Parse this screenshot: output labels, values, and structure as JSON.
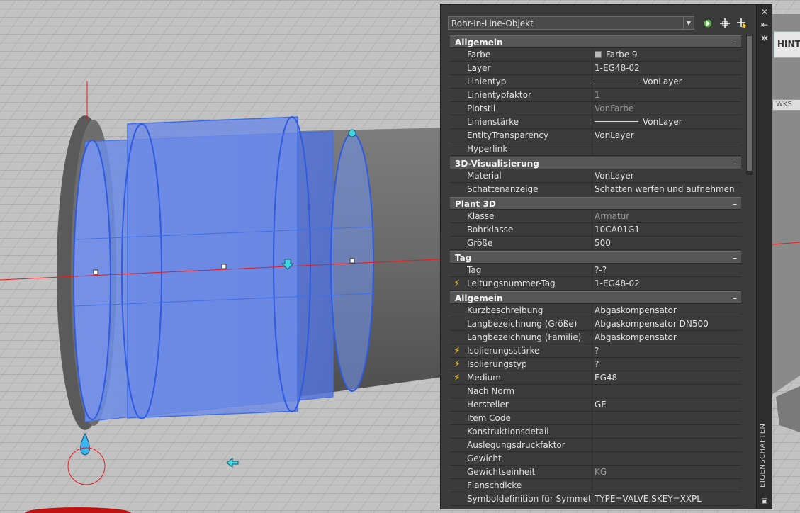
{
  "viewport": {
    "hint_tag": "HINT",
    "wcs_tag": "WKS",
    "selection_color": "#3f6fe8",
    "axis_color": "#e81a1a"
  },
  "palette": {
    "selector": "Rohr-In-Line-Objekt",
    "side_title": "EIGENSCHAFTEN",
    "toolbar_icons": [
      "select-objects-icon",
      "pick-point-icon",
      "quick-select-icon"
    ],
    "strip_icons": [
      "close-icon",
      "auto-hide-icon",
      "settings-icon",
      "properties-mini-icon"
    ],
    "accent_bolt": "#ffd21a",
    "sections": [
      {
        "title": "Allgemein",
        "toggle": "–",
        "rows": [
          {
            "name": "Farbe",
            "value": "Farbe 9",
            "swatch": true
          },
          {
            "name": "Layer",
            "value": "1-EG48-02"
          },
          {
            "name": "Linientyp",
            "value": "VonLayer",
            "line": true
          },
          {
            "name": "Linientypfaktor",
            "value": "1",
            "dim": true
          },
          {
            "name": "Plotstil",
            "value": "VonFarbe",
            "dim": true
          },
          {
            "name": "Linienstärke",
            "value": "VonLayer",
            "line": true
          },
          {
            "name": "EntityTransparency",
            "value": "VonLayer"
          },
          {
            "name": "Hyperlink",
            "value": ""
          }
        ]
      },
      {
        "title": "3D-Visualisierung",
        "toggle": "–",
        "rows": [
          {
            "name": "Material",
            "value": "VonLayer"
          },
          {
            "name": "Schattenanzeige",
            "value": "Schatten werfen und aufnehmen"
          }
        ]
      },
      {
        "title": "Plant 3D",
        "toggle": "–",
        "rows": [
          {
            "name": "Klasse",
            "value": "Armatur",
            "dim": true
          },
          {
            "name": "Rohrklasse",
            "value": "10CA01G1"
          },
          {
            "name": "Größe",
            "value": "500"
          }
        ]
      },
      {
        "title": "Tag",
        "toggle": "–",
        "rows": [
          {
            "name": "Tag",
            "value": "?-?"
          },
          {
            "name": "Leitungsnummer-Tag",
            "value": "1-EG48-02",
            "bolt": true
          }
        ]
      },
      {
        "title": "Allgemein",
        "toggle": "–",
        "rows": [
          {
            "name": "Kurzbeschreibung",
            "value": "Abgaskompensator"
          },
          {
            "name": "Langbezeichnung (Größe)",
            "value": "Abgaskompensator DN500"
          },
          {
            "name": "Langbezeichnung (Familie)",
            "value": "Abgaskompensator"
          },
          {
            "name": "Isolierungsstärke",
            "value": "?",
            "bolt": true
          },
          {
            "name": "Isolierungstyp",
            "value": "?",
            "bolt": true
          },
          {
            "name": "Medium",
            "value": "EG48",
            "bolt": true
          },
          {
            "name": "Nach Norm",
            "value": ""
          },
          {
            "name": "Hersteller",
            "value": "GE"
          },
          {
            "name": "Item Code",
            "value": ""
          },
          {
            "name": "Konstruktionsdetail",
            "value": ""
          },
          {
            "name": "Auslegungsdruckfaktor",
            "value": ""
          },
          {
            "name": "Gewicht",
            "value": ""
          },
          {
            "name": "Gewichtseinheit",
            "value": "KG",
            "dim": true
          },
          {
            "name": "Flanschdicke",
            "value": ""
          },
          {
            "name": "Symboldefinition für Symmetrie",
            "value": "TYPE=VALVE,SKEY=XXPL"
          }
        ]
      }
    ]
  }
}
